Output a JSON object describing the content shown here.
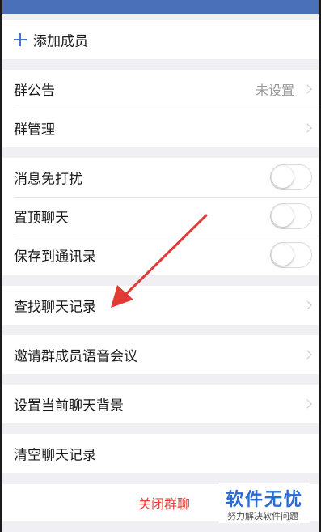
{
  "add_member": {
    "label": "添加成员",
    "icon": "plus-icon"
  },
  "group_notice": {
    "label": "群公告",
    "value": "未设置"
  },
  "group_manage": {
    "label": "群管理"
  },
  "toggles": [
    {
      "label": "消息免打扰",
      "on": false
    },
    {
      "label": "置顶聊天",
      "on": false
    },
    {
      "label": "保存到通讯录",
      "on": false
    }
  ],
  "find_history": {
    "label": "查找聊天记录"
  },
  "voice_meeting": {
    "label": "邀请群成员语音会议"
  },
  "chat_background": {
    "label": "设置当前聊天背景"
  },
  "clear_history": {
    "label": "清空聊天记录"
  },
  "close_group": {
    "label": "关闭群聊"
  },
  "watermark": {
    "title": "软件无忧",
    "subtitle": "努力解决软件问题"
  },
  "colors": {
    "topbar": "#4a70b9",
    "accent": "#3d78d8",
    "danger": "#e64340",
    "annotation_arrow": "#e23b35"
  }
}
